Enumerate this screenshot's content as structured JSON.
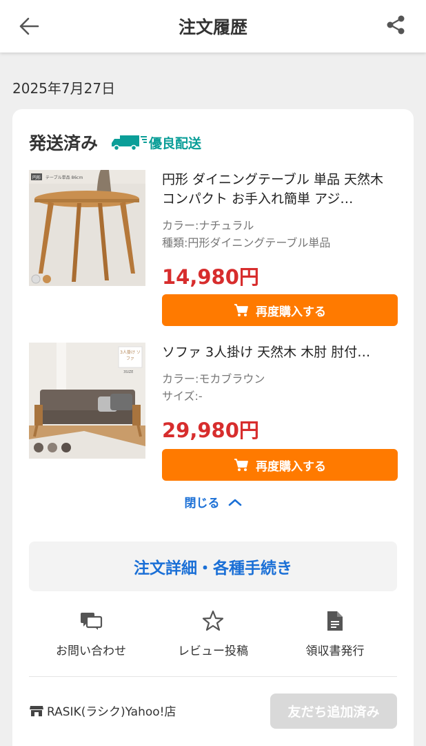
{
  "header": {
    "title": "注文履歴"
  },
  "order": {
    "date": "2025年7月27日",
    "status": "発送済み",
    "delivery_badge": "優良配送",
    "items": [
      {
        "title": "円形 ダイニングテーブル 単品 天然木 コンパクト お手入れ簡単 アジ…",
        "attr1": "カラー:ナチュラル",
        "attr2": "種類:円形ダイニングテーブル単品",
        "price": "14,980円",
        "thumb_tag": "円形",
        "thumb_caption": "テーブル単品 86cm",
        "rebuy_label": "再度購入する"
      },
      {
        "title": "ソファ 3人掛け 天然木 木肘 肘付…",
        "attr1": "カラー:モカブラウン",
        "attr2": "サイズ:-",
        "price": "29,980円",
        "thumb_tag": "3人掛け ソファ",
        "thumb_caption": "3SIZE",
        "rebuy_label": "再度購入する"
      }
    ],
    "collapse_label": "閉じる",
    "detail_button": "注文詳細・各種手続き",
    "actions": {
      "inquiry": "お問い合わせ",
      "review": "レビュー投稿",
      "receipt": "領収書発行"
    },
    "store_name": "RASIK(ラシク)Yahoo!店",
    "friend_button": "友だち追加済み"
  },
  "colors": {
    "accent_orange": "#ff7a00",
    "price_red": "#d72d2d",
    "link_blue": "#1a6fd6",
    "badge_teal": "#0b9e98"
  }
}
